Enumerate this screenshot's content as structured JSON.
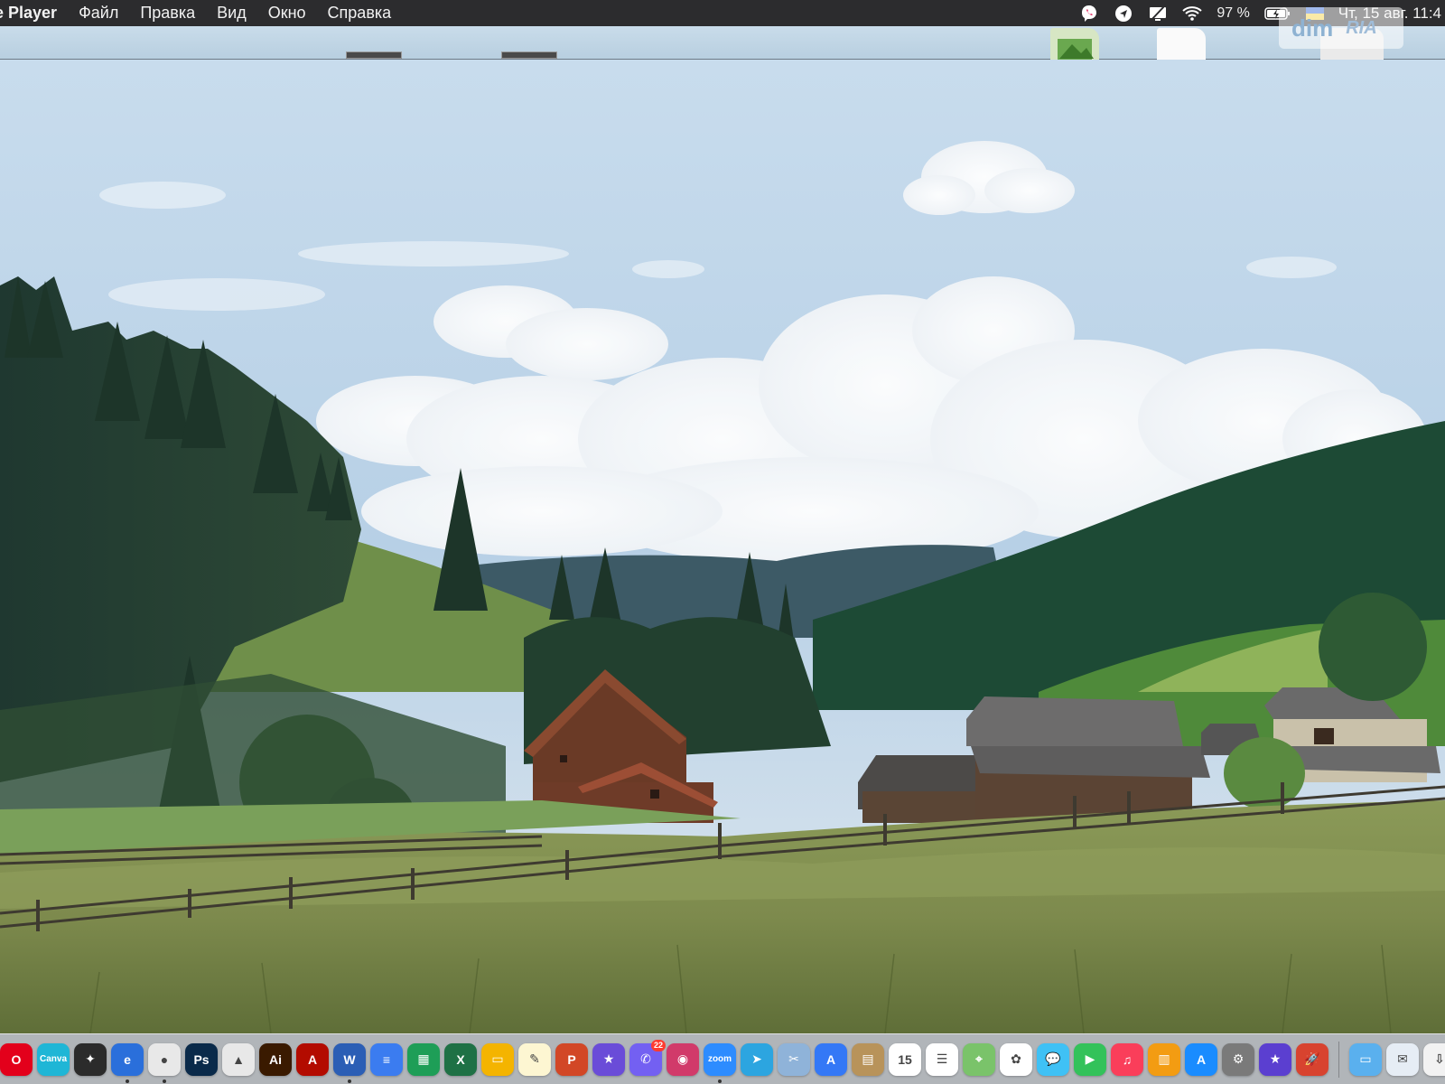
{
  "menubar": {
    "app_name": "e Player",
    "menus": [
      "Файл",
      "Правка",
      "Вид",
      "Окно",
      "Справка"
    ],
    "status": {
      "battery_percent": "97 %",
      "datetime": "Чт, 15 авг.  11:4"
    }
  },
  "watermark": {
    "brand": "dim",
    "sub": "RIA"
  },
  "dock": {
    "running_indicator_color": "#333333",
    "apps": [
      {
        "name": "opera-icon",
        "glyph": "O",
        "bg": "#e3001b",
        "running": false
      },
      {
        "name": "canva-icon",
        "glyph": "Canva",
        "bg": "#1fb6d6",
        "running": false
      },
      {
        "name": "figma-icon",
        "glyph": "✦",
        "bg": "#2b2b2b",
        "running": false
      },
      {
        "name": "edge-icon",
        "glyph": "e",
        "bg": "#2a6fdb",
        "running": true
      },
      {
        "name": "chrome-icon",
        "glyph": "●",
        "bg": "#e8e8e8",
        "running": true
      },
      {
        "name": "photoshop-icon",
        "glyph": "Ps",
        "bg": "#0a2a4a",
        "running": false
      },
      {
        "name": "google-drive-icon",
        "glyph": "▲",
        "bg": "#e8e8e8",
        "running": false
      },
      {
        "name": "illustrator-icon",
        "glyph": "Ai",
        "bg": "#3a1a00",
        "running": false
      },
      {
        "name": "acrobat-icon",
        "glyph": "A",
        "bg": "#b30b00",
        "running": false
      },
      {
        "name": "word-icon",
        "glyph": "W",
        "bg": "#2b5eb5",
        "running": true
      },
      {
        "name": "google-docs-icon",
        "glyph": "≡",
        "bg": "#3b7cf0",
        "running": false
      },
      {
        "name": "google-sheets-icon",
        "glyph": "▦",
        "bg": "#1e9e57",
        "running": false
      },
      {
        "name": "excel-icon",
        "glyph": "X",
        "bg": "#1e7145",
        "running": false
      },
      {
        "name": "google-slides-icon",
        "glyph": "▭",
        "bg": "#f4b400",
        "running": false
      },
      {
        "name": "notes-icon",
        "glyph": "✎",
        "bg": "#fdf6d2",
        "running": false
      },
      {
        "name": "powerpoint-icon",
        "glyph": "P",
        "bg": "#d24726",
        "running": false
      },
      {
        "name": "imovie-icon",
        "glyph": "★",
        "bg": "#6a4cd8",
        "running": false
      },
      {
        "name": "viber-icon",
        "glyph": "✆",
        "bg": "#7360f2",
        "running": false,
        "badge": "22"
      },
      {
        "name": "photo-booth-icon",
        "glyph": "◉",
        "bg": "#d13a6a",
        "running": false
      },
      {
        "name": "zoom-icon",
        "glyph": "zoom",
        "bg": "#2d8cff",
        "running": true
      },
      {
        "name": "telegram-icon",
        "glyph": "➤",
        "bg": "#2ca5e0",
        "running": false
      },
      {
        "name": "preview-icon",
        "glyph": "✂",
        "bg": "#8fb3d9",
        "running": false
      },
      {
        "name": "translate-icon",
        "glyph": "A",
        "bg": "#3478f6",
        "running": false
      },
      {
        "name": "contacts-icon",
        "glyph": "▤",
        "bg": "#b8935a",
        "running": false
      },
      {
        "name": "calendar-icon",
        "glyph": "15",
        "bg": "#ffffff",
        "running": false
      },
      {
        "name": "reminders-icon",
        "glyph": "☰",
        "bg": "#ffffff",
        "running": false
      },
      {
        "name": "maps-icon",
        "glyph": "⌖",
        "bg": "#7ac36a",
        "running": false
      },
      {
        "name": "photos-icon",
        "glyph": "✿",
        "bg": "#ffffff",
        "running": false
      },
      {
        "name": "messages-icon",
        "glyph": "💬",
        "bg": "#3fc1f5",
        "running": false
      },
      {
        "name": "facetime-icon",
        "glyph": "▶",
        "bg": "#33c25a",
        "running": false
      },
      {
        "name": "music-icon",
        "glyph": "♫",
        "bg": "#fa3e5a",
        "running": false
      },
      {
        "name": "books-icon",
        "glyph": "▥",
        "bg": "#f39c12",
        "running": false
      },
      {
        "name": "app-store-icon",
        "glyph": "A",
        "bg": "#1a8cff",
        "running": false
      },
      {
        "name": "system-settings-icon",
        "glyph": "⚙",
        "bg": "#7a7a7a",
        "running": false
      },
      {
        "name": "imovie-star-icon",
        "glyph": "★",
        "bg": "#5b3fd0",
        "running": false
      },
      {
        "name": "rocket-typist-icon",
        "glyph": "🚀",
        "bg": "#d8432f",
        "running": false
      }
    ],
    "stack_apps": [
      {
        "name": "folder-icon",
        "glyph": "▭",
        "bg": "#5ab0ee"
      },
      {
        "name": "mail-stack-icon",
        "glyph": "✉",
        "bg": "#e6edf5"
      },
      {
        "name": "downloads-stack-icon",
        "glyph": "⇩",
        "bg": "#f2f2f2"
      }
    ]
  }
}
